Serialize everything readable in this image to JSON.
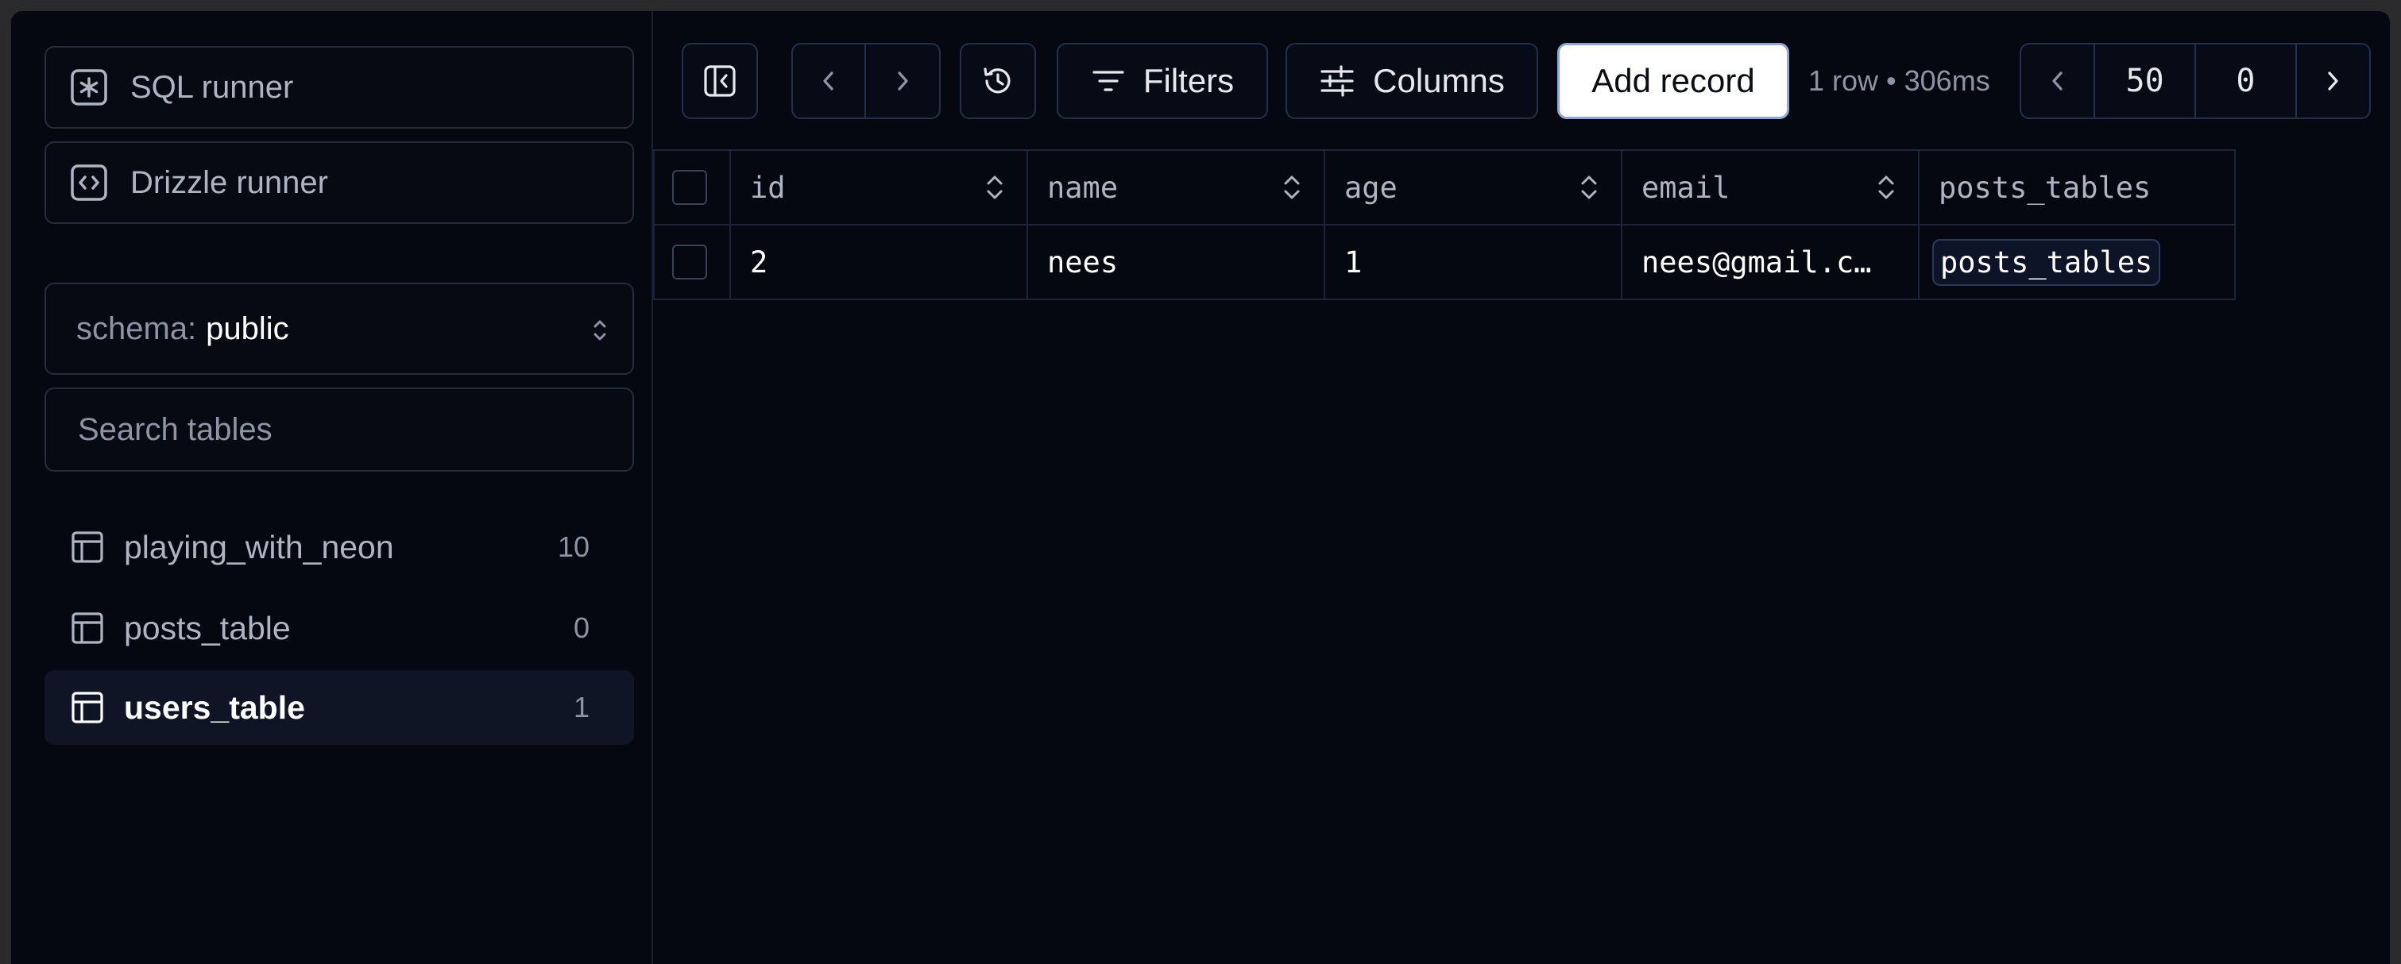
{
  "sidebar": {
    "sql_runner": "SQL runner",
    "drizzle_runner": "Drizzle runner",
    "schema_label": "schema:",
    "schema_value": "public",
    "search_placeholder": "Search tables",
    "tables": [
      {
        "name": "playing_with_neon",
        "count": "10"
      },
      {
        "name": "posts_table",
        "count": "0"
      },
      {
        "name": "users_table",
        "count": "1"
      }
    ]
  },
  "toolbar": {
    "filters_label": "Filters",
    "columns_label": "Columns",
    "add_record_label": "Add record",
    "status": "1 row • 306ms",
    "limit": "50",
    "offset": "0"
  },
  "grid": {
    "columns": [
      "id",
      "name",
      "age",
      "email",
      "posts_tables"
    ],
    "rows": [
      {
        "id": "2",
        "name": "nees",
        "age": "1",
        "email": "nees@gmail.c…",
        "posts_tables": "posts_tables"
      }
    ]
  },
  "colors": {
    "background": "#050810",
    "border": "#243049",
    "primary_button": "#ffffff",
    "active_item": "#0f1524"
  }
}
